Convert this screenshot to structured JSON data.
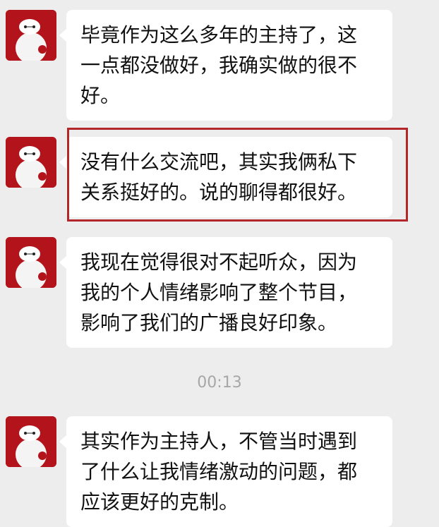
{
  "messages": [
    {
      "sender": "contact",
      "lines": [
        "毕竟作为这么多年的主持了，这",
        "一点都没做好，我确实做的很不",
        "好。"
      ]
    },
    {
      "sender": "contact",
      "highlighted": true,
      "lines": [
        "没有什么交流吧，其实我俩私下",
        "关系挺好的。说的聊得都很好。"
      ]
    },
    {
      "sender": "contact",
      "lines": [
        "我现在觉得很对不起听众，因为",
        "我的个人情绪影响了整个节目，",
        "影响了我们的广播良好印象。"
      ]
    },
    {
      "sender": "contact",
      "lines": [
        "其实作为主持人，不管当时遇到",
        "了什么让我情绪激动的问题，都",
        "应该更好的克制。"
      ]
    }
  ],
  "timestamp": "00:13",
  "colors": {
    "background": "#ededed",
    "bubble": "#ffffff",
    "highlight_border": "#b3262a",
    "avatar_bg": "#b3141b"
  },
  "icons": {
    "avatar": "white-robot-avatar-icon"
  }
}
